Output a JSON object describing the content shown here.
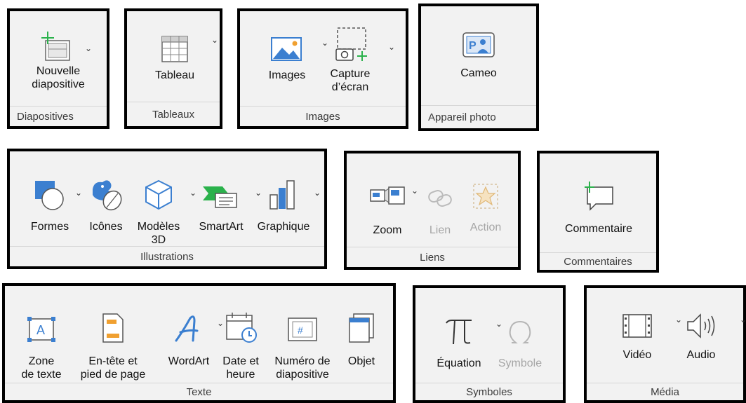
{
  "groups": {
    "diapositives": {
      "title": "Diapositives",
      "new_slide": "Nouvelle\ndiapositive"
    },
    "tableaux": {
      "title": "Tableaux",
      "table": "Tableau"
    },
    "images": {
      "title": "Images",
      "images": "Images",
      "screenshot": "Capture\nd’écran"
    },
    "appareil": {
      "title": "Appareil photo",
      "cameo": "Cameo"
    },
    "illustrations": {
      "title": "Illustrations",
      "shapes": "Formes",
      "icons": "Icônes",
      "models3d": "Modèles\n3D",
      "smartart": "SmartArt",
      "chart": "Graphique"
    },
    "liens": {
      "title": "Liens",
      "zoom": "Zoom",
      "link": "Lien",
      "action": "Action"
    },
    "commentaires": {
      "title": "Commentaires",
      "comment": "Commentaire"
    },
    "texte": {
      "title": "Texte",
      "textbox": "Zone\nde texte",
      "header_footer": "En-tête et\npied de page",
      "wordart": "WordArt",
      "date_time": "Date et\nheure",
      "slide_number": "Numéro de\ndiapositive",
      "object": "Objet"
    },
    "symboles": {
      "title": "Symboles",
      "equation": "Équation",
      "symbol": "Symbole"
    },
    "media": {
      "title": "Média",
      "video": "Vidéo",
      "audio": "Audio"
    }
  },
  "colors": {
    "accent_blue": "#3b7fd0",
    "accent_green": "#2bb24c",
    "accent_orange": "#f0a030",
    "disabled": "#a6a6a6"
  }
}
